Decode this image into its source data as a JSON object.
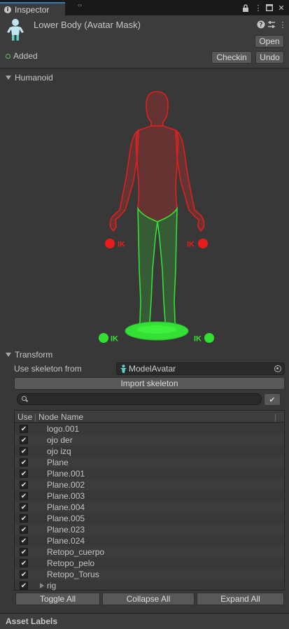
{
  "tab": {
    "title": "Inspector",
    "icon": "info-icon"
  },
  "header": {
    "title": "Lower Body (Avatar Mask)",
    "open_label": "Open",
    "status_label": "Added",
    "checkin_label": "Checkin",
    "undo_label": "Undo"
  },
  "humanoid": {
    "label": "Humanoid",
    "ik_labels": {
      "left_hand": "IK",
      "right_hand": "IK",
      "left_foot": "IK",
      "right_foot": "IK"
    },
    "colors": {
      "disabled": "#e02020",
      "enabled": "#34e034"
    }
  },
  "transform": {
    "label": "Transform",
    "skeleton_label": "Use skeleton from",
    "skeleton_value": "ModelAvatar",
    "import_label": "Import skeleton",
    "search_placeholder": "",
    "columns": {
      "use": "Use",
      "node": "Node Name"
    },
    "nodes": [
      {
        "name": "logo.001",
        "checked": true
      },
      {
        "name": "ojo der",
        "checked": true
      },
      {
        "name": "ojo izq",
        "checked": true
      },
      {
        "name": "Plane",
        "checked": true
      },
      {
        "name": "Plane.001",
        "checked": true
      },
      {
        "name": "Plane.002",
        "checked": true
      },
      {
        "name": "Plane.003",
        "checked": true
      },
      {
        "name": "Plane.004",
        "checked": true
      },
      {
        "name": "Plane.005",
        "checked": true
      },
      {
        "name": "Plane.023",
        "checked": true
      },
      {
        "name": "Plane.024",
        "checked": true
      },
      {
        "name": "Retopo_cuerpo",
        "checked": true
      },
      {
        "name": "Retopo_pelo",
        "checked": true
      },
      {
        "name": "Retopo_Torus",
        "checked": true
      },
      {
        "name": "rig",
        "checked": true,
        "expandable": true
      }
    ],
    "toggle_all_label": "Toggle All",
    "collapse_all_label": "Collapse All",
    "expand_all_label": "Expand All"
  },
  "footer": {
    "asset_labels": "Asset Labels"
  }
}
